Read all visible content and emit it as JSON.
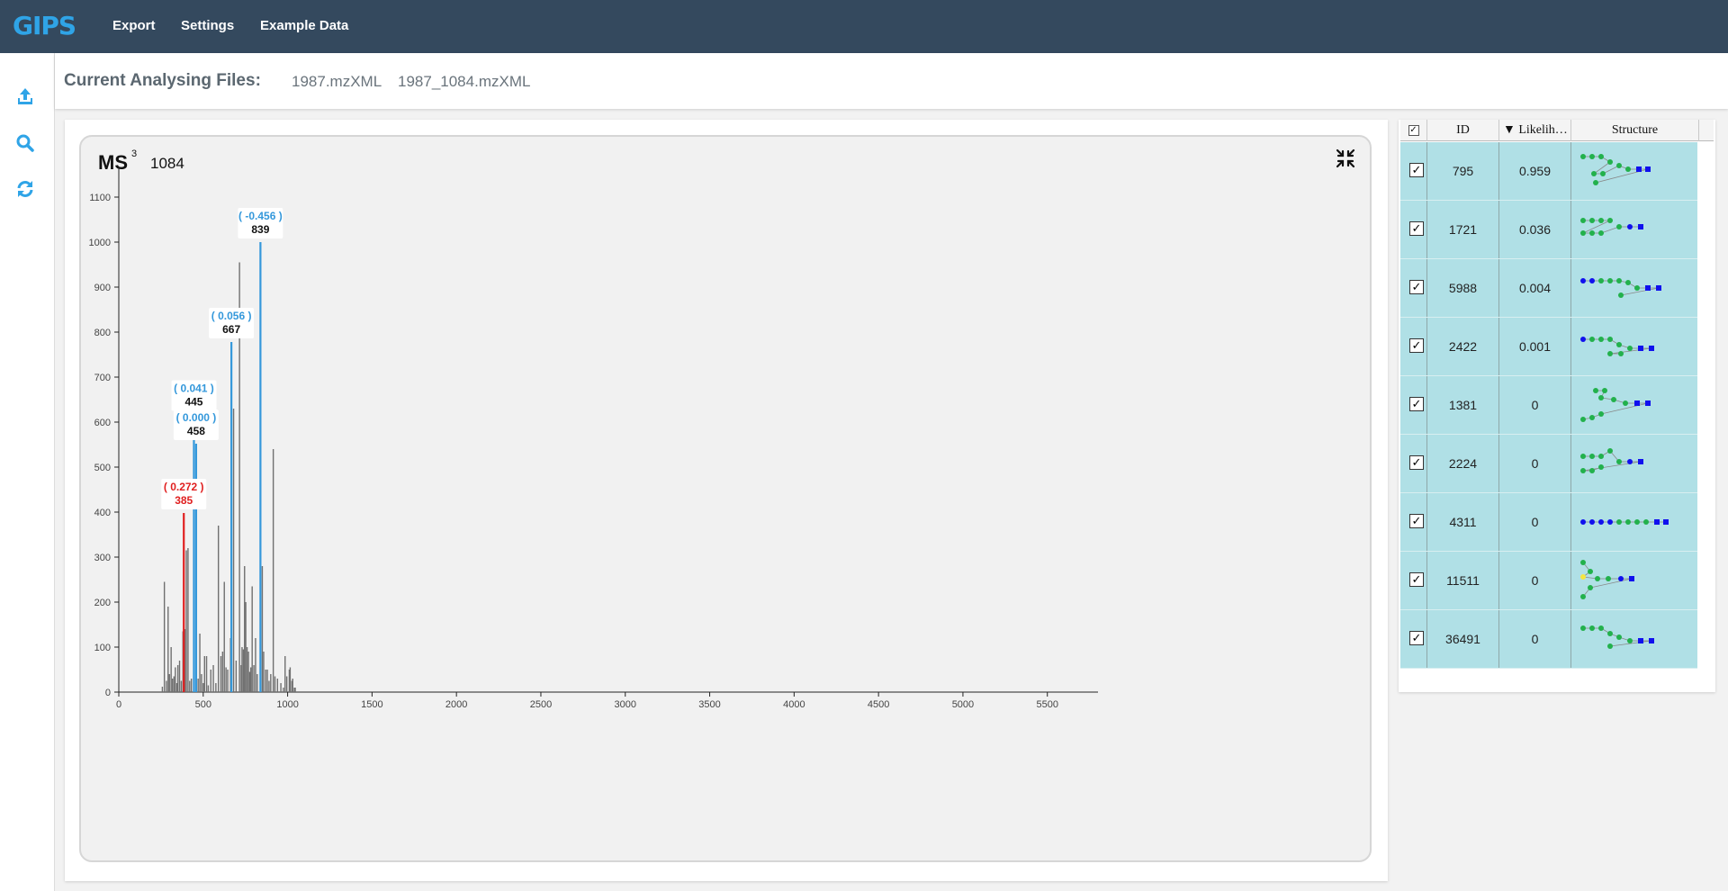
{
  "app": {
    "logo": "GIPS",
    "nav": [
      "Export",
      "Settings",
      "Example Data"
    ]
  },
  "sidebar": {
    "icons": [
      "upload-icon",
      "search-icon",
      "refresh-icon"
    ]
  },
  "files": {
    "label": "Current Analysing Files:",
    "names": [
      "1987.mzXML",
      "1987_1084.mzXML"
    ]
  },
  "plot": {
    "title": "MS",
    "superscript": "3",
    "scan": "1084"
  },
  "colors": {
    "nav_bg": "#34495e",
    "accent": "#2fa4e7",
    "peak_gray": "#707070",
    "peak_blue": "#3498db",
    "peak_red": "#e02020",
    "row_bg": "#b0e0e6"
  },
  "chart_data": {
    "type": "bar",
    "xlim": [
      0,
      5800
    ],
    "ylim": [
      0,
      1150
    ],
    "xticks": [
      0,
      500,
      1000,
      1500,
      2000,
      2500,
      3000,
      3500,
      4000,
      4500,
      5000,
      5500
    ],
    "yticks": [
      0,
      100,
      200,
      300,
      400,
      500,
      600,
      700,
      800,
      900,
      1000,
      1100
    ],
    "grid": false,
    "series": [
      {
        "color": "gray",
        "x": [
          258,
          270,
          282,
          292,
          300,
          310,
          318,
          327,
          335,
          344,
          350,
          360,
          370,
          380,
          392,
          400,
          410,
          420,
          430,
          470,
          480,
          490,
          500,
          508,
          520,
          530,
          545,
          560,
          575,
          590,
          605,
          615,
          625,
          635,
          645,
          662,
          680,
          695,
          715,
          725,
          730,
          738,
          745,
          752,
          760,
          768,
          775,
          782,
          790,
          800,
          810,
          820,
          850,
          858,
          870,
          880,
          890,
          900,
          915,
          925,
          940,
          960,
          975,
          985,
          995,
          1010,
          1015,
          1025,
          1030,
          1040,
          1045
        ],
        "y": [
          12,
          245,
          25,
          190,
          40,
          100,
          30,
          35,
          55,
          20,
          60,
          70,
          25,
          135,
          140,
          315,
          320,
          25,
          30,
          30,
          130,
          40,
          20,
          80,
          80,
          15,
          50,
          60,
          20,
          370,
          80,
          90,
          245,
          55,
          50,
          120,
          630,
          70,
          955,
          60,
          100,
          95,
          280,
          200,
          100,
          90,
          45,
          55,
          235,
          60,
          120,
          40,
          280,
          90,
          50,
          50,
          25,
          40,
          540,
          35,
          30,
          20,
          10,
          80,
          35,
          50,
          55,
          25,
          30,
          10,
          10
        ]
      },
      {
        "color": "blue",
        "x": [
          445,
          458,
          667,
          839
        ],
        "y": [
          617,
          552,
          778,
          1000
        ]
      },
      {
        "color": "red",
        "x": [
          385
        ],
        "y": [
          398
        ]
      }
    ],
    "annotations": [
      {
        "x": 385,
        "y": 398,
        "score": "( 0.272 )",
        "label": "385",
        "color": "red"
      },
      {
        "x": 445,
        "y": 617,
        "score": "( 0.041 )",
        "label": "445",
        "color": "blue"
      },
      {
        "x": 458,
        "y": 552,
        "score": "( 0.000 )",
        "label": "458",
        "color": "blue"
      },
      {
        "x": 667,
        "y": 778,
        "score": "( 0.056 )",
        "label": "667",
        "color": "blue"
      },
      {
        "x": 839,
        "y": 1000,
        "score": "( -0.456 )",
        "label": "839",
        "color": "blue"
      }
    ]
  },
  "table": {
    "headers": [
      "",
      "ID",
      "▼ Likelih…",
      "Structure"
    ],
    "rows": [
      {
        "checked": "✓",
        "id": "795",
        "likelihood": "0.959",
        "structure": "glycan-A"
      },
      {
        "checked": "✓",
        "id": "1721",
        "likelihood": "0.036",
        "structure": "glycan-B"
      },
      {
        "checked": "✓",
        "id": "5988",
        "likelihood": "0.004",
        "structure": "glycan-C"
      },
      {
        "checked": "✓",
        "id": "2422",
        "likelihood": "0.001",
        "structure": "glycan-D"
      },
      {
        "checked": "✓",
        "id": "1381",
        "likelihood": "0",
        "structure": "glycan-E"
      },
      {
        "checked": "✓",
        "id": "2224",
        "likelihood": "0",
        "structure": "glycan-F"
      },
      {
        "checked": "✓",
        "id": "4311",
        "likelihood": "0",
        "structure": "glycan-G"
      },
      {
        "checked": "✓",
        "id": "11511",
        "likelihood": "0",
        "structure": "glycan-H"
      },
      {
        "checked": "✓",
        "id": "36491",
        "likelihood": "0",
        "structure": "glycan-I"
      }
    ]
  }
}
